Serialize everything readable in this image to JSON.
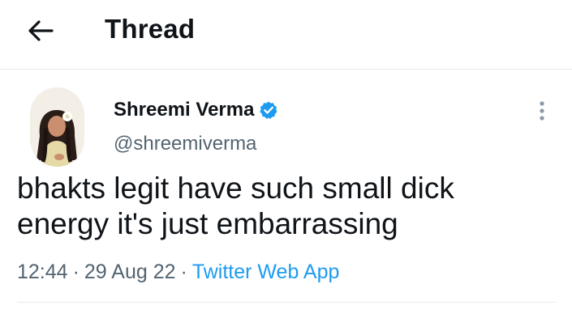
{
  "header": {
    "title": "Thread",
    "back_icon": "arrow-left-icon"
  },
  "tweet": {
    "author": {
      "name": "Shreemi Verma",
      "handle": "@shreemiverma",
      "verified": true,
      "verified_color": "#1d9bf0"
    },
    "text": "bhakts legit have such small dick\nenergy it's just embarrassing",
    "time": "12:44",
    "date": "29 Aug 22",
    "separator": "·",
    "source": "Twitter Web App",
    "source_color": "#1d9bf0"
  }
}
